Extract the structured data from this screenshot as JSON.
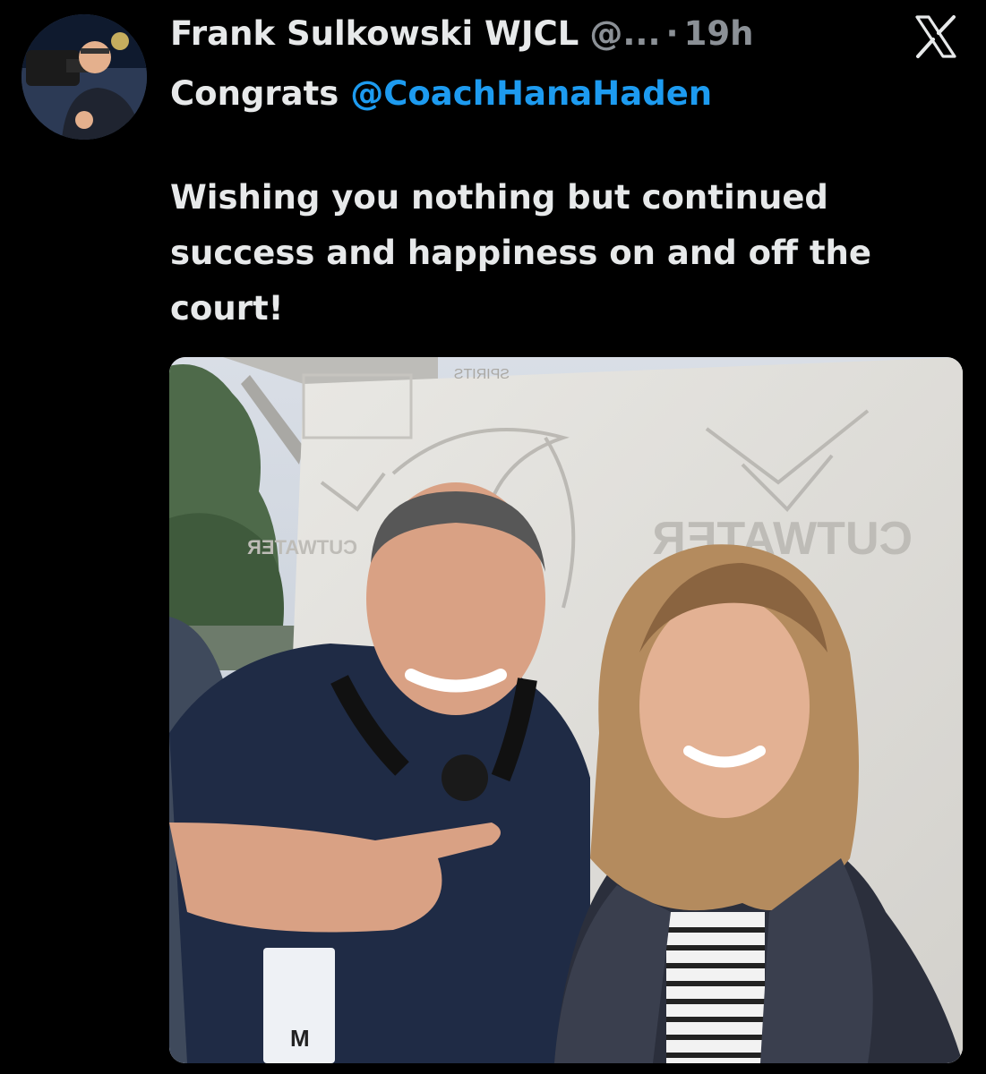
{
  "tweet": {
    "author": {
      "display_name": "Frank Sulkowski WJCL",
      "handle": "@...",
      "avatar_icon": "user-avatar"
    },
    "separator": "·",
    "timestamp": "19h",
    "platform_icon": "x-logo-icon",
    "body": {
      "greeting": "Congrats ",
      "mention": "@CoachHanaHaden",
      "message": "Wishing you nothing but continued success and happiness on and off the court!"
    },
    "media": {
      "backdrop_text_left": "CUTWATER",
      "backdrop_text_right": "CUTWATER",
      "backdrop_text_small": "SPIRITS",
      "badge_letter": "M"
    }
  },
  "colors": {
    "background": "#000000",
    "text": "#e7e9ea",
    "muted": "#8b9096",
    "accent": "#1d9bf0"
  }
}
